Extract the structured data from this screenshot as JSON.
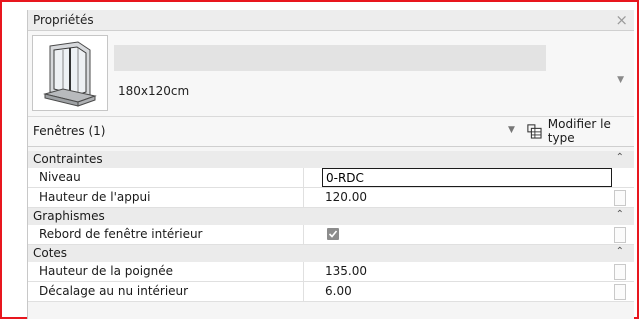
{
  "palette": {
    "title": "Propriétés",
    "close_glyph": "×"
  },
  "type_selector": {
    "type_name": "180x120cm",
    "preview_icon": "window-icon",
    "dropdown_glyph": "▼"
  },
  "category": {
    "label": "Fenêtres (1)",
    "dropdown_glyph": "▼",
    "edit_type_label": "Modifier le type",
    "edit_type_icon": "edit-type-icon"
  },
  "groups": [
    {
      "label": "Contraintes",
      "collapse_glyph": "⌃",
      "params": [
        {
          "name": "Niveau",
          "value": "0-RDC"
        },
        {
          "name": "Hauteur de l'appui",
          "value": "120.00"
        }
      ]
    },
    {
      "label": "Graphismes",
      "collapse_glyph": "⌃",
      "params": [
        {
          "name": "Rebord de fenêtre intérieur",
          "checked": true
        }
      ]
    },
    {
      "label": "Cotes",
      "collapse_glyph": "⌃",
      "params": [
        {
          "name": "Hauteur de la poignée",
          "value": "135.00"
        },
        {
          "name": "Décalage au nu intérieur",
          "value": "6.00"
        }
      ]
    }
  ],
  "colors": {
    "frame_border": "#e8161e",
    "palette_bg": "#f5f5f5",
    "group_bg": "#ebebeb"
  }
}
